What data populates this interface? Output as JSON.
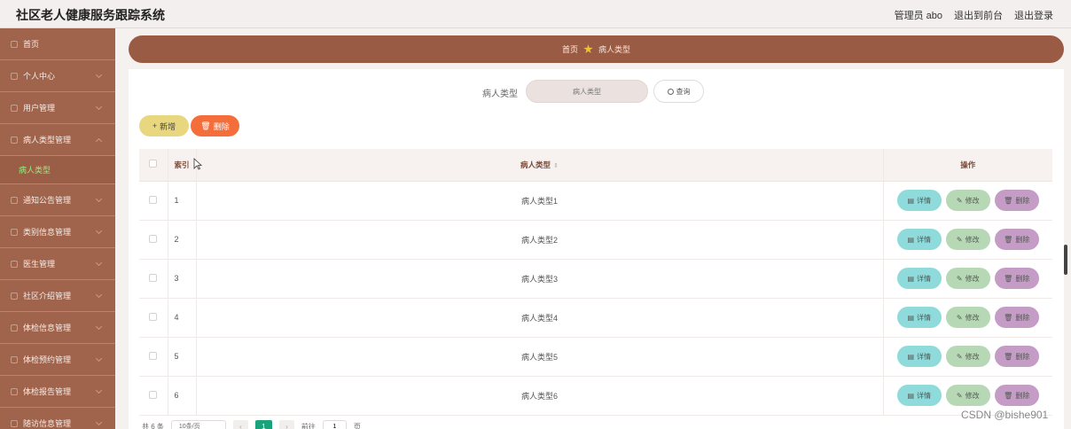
{
  "header": {
    "title": "社区老人健康服务跟踪系统",
    "admin": "管理员 abo",
    "to_front": "退出到前台",
    "logout": "退出登录"
  },
  "sidebar": {
    "items": [
      {
        "label": "首页"
      },
      {
        "label": "个人中心"
      },
      {
        "label": "用户管理"
      },
      {
        "label": "病人类型管理"
      },
      {
        "label": "通知公告管理"
      },
      {
        "label": "类别信息管理"
      },
      {
        "label": "医生管理"
      },
      {
        "label": "社区介绍管理"
      },
      {
        "label": "体检信息管理"
      },
      {
        "label": "体检预约管理"
      },
      {
        "label": "体检报告管理"
      },
      {
        "label": "随访信息管理"
      }
    ],
    "active_sub": "病人类型"
  },
  "breadcrumb": {
    "home": "首页",
    "current": "病人类型"
  },
  "search": {
    "label": "病人类型",
    "placeholder": "病人类型",
    "button": "查询"
  },
  "toolbar": {
    "add": "新增",
    "delete": "删除"
  },
  "table": {
    "headers": {
      "index": "索引",
      "type": "病人类型",
      "ops": "操作"
    },
    "rows": [
      {
        "index": "1",
        "type": "病人类型1"
      },
      {
        "index": "2",
        "type": "病人类型2"
      },
      {
        "index": "3",
        "type": "病人类型3"
      },
      {
        "index": "4",
        "type": "病人类型4"
      },
      {
        "index": "5",
        "type": "病人类型5"
      },
      {
        "index": "6",
        "type": "病人类型6"
      }
    ],
    "ops": {
      "detail": "详情",
      "edit": "修改",
      "delete": "删除"
    }
  },
  "pager": {
    "total": "共 6 条",
    "page_size": "10条/页",
    "current": "1",
    "goto_label": "前往",
    "goto_value": "1",
    "page_unit": "页"
  },
  "watermark": "CSDN @bishe901",
  "colors": {
    "sidebar_bg": "#a0644c",
    "breadcrumb_bg": "#9a5b44",
    "accent_green": "#1aa37a",
    "add_btn": "#e9d77f",
    "delete_btn": "#f46e3c",
    "detail_btn": "#8fdada",
    "edit_btn": "#b7d8b5",
    "row_delete_btn": "#c49cc6"
  }
}
